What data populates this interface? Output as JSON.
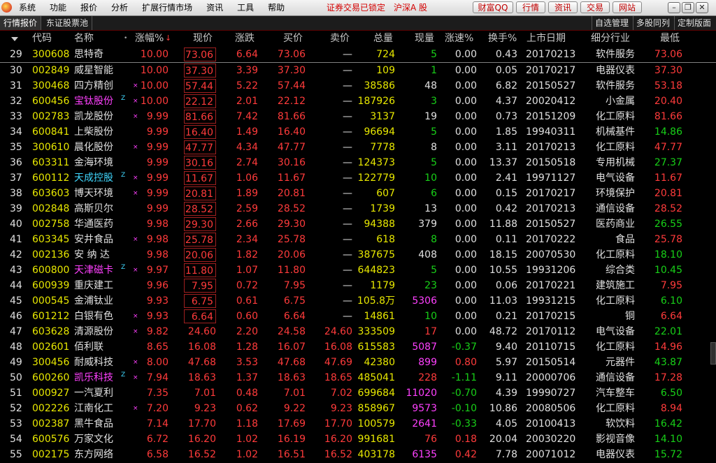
{
  "menu": [
    "系统",
    "功能",
    "报价",
    "分析",
    "扩展行情市场",
    "资讯",
    "工具",
    "帮助"
  ],
  "status_lock": "证券交易已锁定",
  "market_selector": "沪深A 股",
  "toolbar_buttons": [
    "财富QQ",
    "行情",
    "资讯",
    "交易",
    "网站"
  ],
  "window_controls": [
    "minimize",
    "restore",
    "close"
  ],
  "tabs": [
    "行情报价",
    "东证股票池"
  ],
  "right_tabs": [
    "自选管理",
    "多股同列",
    "定制版面"
  ],
  "columns": [
    "代码",
    "名称",
    "•",
    "涨幅%",
    "现价",
    "涨跌",
    "买价",
    "卖价",
    "总量",
    "现量",
    "涨速%",
    "换手%",
    "上市日期",
    "细分行业",
    "最低"
  ],
  "sort_indicator": "↓",
  "colors": {
    "up": "#ff3b3b",
    "down": "#18d018",
    "code": "#e8e800",
    "name_highlight": "#ff40ff",
    "name_cyan": "#40d8ff",
    "text": "#e0e0e0"
  },
  "rows": [
    {
      "n": "29",
      "code": "300608",
      "name": "思特奇",
      "nc": "w",
      "flag": "",
      "mark": "",
      "chg": "10.00",
      "price": "73.06",
      "diff": "6.64",
      "bid": "73.06",
      "ask": "—",
      "vol": "724",
      "cur": "5",
      "curc": "g",
      "speed": "0.00",
      "spc": "w",
      "turn": "0.43",
      "date": "20170213",
      "ind": "软件服务",
      "low": "73.06",
      "lowc": "r"
    },
    {
      "n": "30",
      "code": "002849",
      "name": "威星智能",
      "nc": "w",
      "flag": "",
      "mark": "",
      "chg": "10.00",
      "price": "37.30",
      "diff": "3.39",
      "bid": "37.30",
      "ask": "—",
      "vol": "109",
      "cur": "1",
      "curc": "g",
      "speed": "0.00",
      "spc": "w",
      "turn": "0.05",
      "date": "20170217",
      "ind": "电器仪表",
      "low": "37.30",
      "lowc": "r"
    },
    {
      "n": "31",
      "code": "300468",
      "name": "四方精创",
      "nc": "w",
      "flag": "",
      "mark": "×",
      "chg": "10.00",
      "price": "57.44",
      "diff": "5.22",
      "bid": "57.44",
      "ask": "—",
      "vol": "38586",
      "cur": "48",
      "curc": "w",
      "speed": "0.00",
      "spc": "w",
      "turn": "6.82",
      "date": "20150527",
      "ind": "软件服务",
      "low": "53.18",
      "lowc": "r"
    },
    {
      "n": "32",
      "code": "600456",
      "name": "宝钛股份",
      "nc": "m",
      "flag": "Z",
      "mark": "×",
      "chg": "10.00",
      "price": "22.12",
      "diff": "2.01",
      "bid": "22.12",
      "ask": "—",
      "vol": "187926",
      "cur": "3",
      "curc": "g",
      "speed": "0.00",
      "spc": "w",
      "turn": "4.37",
      "date": "20020412",
      "ind": "小金属",
      "low": "20.40",
      "lowc": "r"
    },
    {
      "n": "33",
      "code": "002783",
      "name": "凯龙股份",
      "nc": "w",
      "flag": "",
      "mark": "×",
      "chg": "9.99",
      "price": "81.66",
      "diff": "7.42",
      "bid": "81.66",
      "ask": "—",
      "vol": "3137",
      "cur": "19",
      "curc": "w",
      "speed": "0.00",
      "spc": "w",
      "turn": "0.73",
      "date": "20151209",
      "ind": "化工原料",
      "low": "81.66",
      "lowc": "r"
    },
    {
      "n": "34",
      "code": "600841",
      "name": "上柴股份",
      "nc": "w",
      "flag": "",
      "mark": "",
      "chg": "9.99",
      "price": "16.40",
      "diff": "1.49",
      "bid": "16.40",
      "ask": "—",
      "vol": "96694",
      "cur": "5",
      "curc": "g",
      "speed": "0.00",
      "spc": "w",
      "turn": "1.85",
      "date": "19940311",
      "ind": "机械基件",
      "low": "14.86",
      "lowc": "g"
    },
    {
      "n": "35",
      "code": "300610",
      "name": "晨化股份",
      "nc": "w",
      "flag": "",
      "mark": "×",
      "chg": "9.99",
      "price": "47.77",
      "diff": "4.34",
      "bid": "47.77",
      "ask": "—",
      "vol": "7778",
      "cur": "8",
      "curc": "w",
      "speed": "0.00",
      "spc": "w",
      "turn": "3.11",
      "date": "20170213",
      "ind": "化工原料",
      "low": "47.77",
      "lowc": "r"
    },
    {
      "n": "36",
      "code": "603311",
      "name": "金海环境",
      "nc": "w",
      "flag": "",
      "mark": "",
      "chg": "9.99",
      "price": "30.16",
      "diff": "2.74",
      "bid": "30.16",
      "ask": "—",
      "vol": "124373",
      "cur": "5",
      "curc": "g",
      "speed": "0.00",
      "spc": "w",
      "turn": "13.37",
      "date": "20150518",
      "ind": "专用机械",
      "low": "27.37",
      "lowc": "g"
    },
    {
      "n": "37",
      "code": "600112",
      "name": "天成控股",
      "nc": "c",
      "flag": "Z",
      "mark": "×",
      "chg": "9.99",
      "price": "11.67",
      "diff": "1.06",
      "bid": "11.67",
      "ask": "—",
      "vol": "122779",
      "cur": "10",
      "curc": "g",
      "speed": "0.00",
      "spc": "w",
      "turn": "2.41",
      "date": "19971127",
      "ind": "电气设备",
      "low": "11.67",
      "lowc": "r"
    },
    {
      "n": "38",
      "code": "603603",
      "name": "博天环境",
      "nc": "w",
      "flag": "",
      "mark": "×",
      "chg": "9.99",
      "price": "20.81",
      "diff": "1.89",
      "bid": "20.81",
      "ask": "—",
      "vol": "607",
      "cur": "6",
      "curc": "g",
      "speed": "0.00",
      "spc": "w",
      "turn": "0.15",
      "date": "20170217",
      "ind": "环境保护",
      "low": "20.81",
      "lowc": "r"
    },
    {
      "n": "39",
      "code": "002848",
      "name": "高斯贝尔",
      "nc": "w",
      "flag": "",
      "mark": "",
      "chg": "9.99",
      "price": "28.52",
      "diff": "2.59",
      "bid": "28.52",
      "ask": "—",
      "vol": "1739",
      "cur": "13",
      "curc": "w",
      "speed": "0.00",
      "spc": "w",
      "turn": "0.42",
      "date": "20170213",
      "ind": "通信设备",
      "low": "28.52",
      "lowc": "r"
    },
    {
      "n": "40",
      "code": "002758",
      "name": "华通医药",
      "nc": "w",
      "flag": "",
      "mark": "",
      "chg": "9.98",
      "price": "29.30",
      "diff": "2.66",
      "bid": "29.30",
      "ask": "—",
      "vol": "94388",
      "cur": "379",
      "curc": "w",
      "speed": "0.00",
      "spc": "w",
      "turn": "11.88",
      "date": "20150527",
      "ind": "医药商业",
      "low": "26.55",
      "lowc": "g"
    },
    {
      "n": "41",
      "code": "603345",
      "name": "安井食品",
      "nc": "w",
      "flag": "",
      "mark": "×",
      "chg": "9.98",
      "price": "25.78",
      "diff": "2.34",
      "bid": "25.78",
      "ask": "—",
      "vol": "618",
      "cur": "8",
      "curc": "g",
      "speed": "0.00",
      "spc": "w",
      "turn": "0.11",
      "date": "20170222",
      "ind": "食品",
      "low": "25.78",
      "lowc": "r"
    },
    {
      "n": "42",
      "code": "002136",
      "name": "安 纳 达",
      "nc": "w",
      "flag": "",
      "mark": "",
      "chg": "9.98",
      "price": "20.06",
      "diff": "1.82",
      "bid": "20.06",
      "ask": "—",
      "vol": "387675",
      "cur": "408",
      "curc": "w",
      "speed": "0.00",
      "spc": "w",
      "turn": "18.15",
      "date": "20070530",
      "ind": "化工原料",
      "low": "18.10",
      "lowc": "g"
    },
    {
      "n": "43",
      "code": "600800",
      "name": "天津磁卡",
      "nc": "m",
      "flag": "Z",
      "mark": "×",
      "chg": "9.97",
      "price": "11.80",
      "diff": "1.07",
      "bid": "11.80",
      "ask": "—",
      "vol": "644823",
      "cur": "5",
      "curc": "g",
      "speed": "0.00",
      "spc": "w",
      "turn": "10.55",
      "date": "19931206",
      "ind": "综合类",
      "low": "10.45",
      "lowc": "g"
    },
    {
      "n": "44",
      "code": "600939",
      "name": "重庆建工",
      "nc": "w",
      "flag": "",
      "mark": "",
      "chg": "9.96",
      "price": "7.95",
      "diff": "0.72",
      "bid": "7.95",
      "ask": "—",
      "vol": "1179",
      "cur": "23",
      "curc": "g",
      "speed": "0.00",
      "spc": "w",
      "turn": "0.06",
      "date": "20170221",
      "ind": "建筑施工",
      "low": "7.95",
      "lowc": "r"
    },
    {
      "n": "45",
      "code": "000545",
      "name": "金浦钛业",
      "nc": "w",
      "flag": "",
      "mark": "",
      "chg": "9.93",
      "price": "6.75",
      "diff": "0.61",
      "bid": "6.75",
      "ask": "—",
      "vol": "105.8万",
      "cur": "5306",
      "curc": "m",
      "speed": "0.00",
      "spc": "w",
      "turn": "11.03",
      "date": "19931215",
      "ind": "化工原料",
      "low": "6.10",
      "lowc": "g"
    },
    {
      "n": "46",
      "code": "601212",
      "name": "白银有色",
      "nc": "w",
      "flag": "",
      "mark": "×",
      "chg": "9.93",
      "price": "6.64",
      "diff": "0.60",
      "bid": "6.64",
      "ask": "—",
      "vol": "14861",
      "cur": "10",
      "curc": "g",
      "speed": "0.00",
      "spc": "w",
      "turn": "0.21",
      "date": "20170215",
      "ind": "铜",
      "low": "6.64",
      "lowc": "r"
    },
    {
      "n": "47",
      "code": "603628",
      "name": "清源股份",
      "nc": "w",
      "flag": "",
      "mark": "×",
      "chg": "9.82",
      "price": "24.60",
      "diff": "2.20",
      "bid": "24.58",
      "ask": "24.60",
      "vol": "333509",
      "cur": "17",
      "curc": "r",
      "speed": "0.00",
      "spc": "w",
      "turn": "48.72",
      "date": "20170112",
      "ind": "电气设备",
      "low": "22.01",
      "lowc": "g"
    },
    {
      "n": "48",
      "code": "002601",
      "name": "佰利联",
      "nc": "w",
      "flag": "",
      "mark": "",
      "chg": "8.65",
      "price": "16.08",
      "diff": "1.28",
      "bid": "16.07",
      "ask": "16.08",
      "vol": "615583",
      "cur": "5087",
      "curc": "m",
      "speed": "-0.37",
      "spc": "g",
      "turn": "9.40",
      "date": "20110715",
      "ind": "化工原料",
      "low": "14.96",
      "lowc": "r"
    },
    {
      "n": "49",
      "code": "300456",
      "name": "耐威科技",
      "nc": "w",
      "flag": "",
      "mark": "×",
      "chg": "8.00",
      "price": "47.68",
      "diff": "3.53",
      "bid": "47.68",
      "ask": "47.69",
      "vol": "42380",
      "cur": "899",
      "curc": "m",
      "speed": "0.80",
      "spc": "r",
      "turn": "5.97",
      "date": "20150514",
      "ind": "元器件",
      "low": "43.87",
      "lowc": "g"
    },
    {
      "n": "50",
      "code": "600260",
      "name": "凯乐科技",
      "nc": "m",
      "flag": "Z",
      "mark": "×",
      "chg": "7.94",
      "price": "18.63",
      "diff": "1.37",
      "bid": "18.63",
      "ask": "18.65",
      "vol": "485041",
      "cur": "228",
      "curc": "r",
      "speed": "-1.11",
      "spc": "g",
      "turn": "9.11",
      "date": "20000706",
      "ind": "通信设备",
      "low": "17.28",
      "lowc": "r"
    },
    {
      "n": "51",
      "code": "000927",
      "name": "一汽夏利",
      "nc": "w",
      "flag": "",
      "mark": "",
      "chg": "7.35",
      "price": "7.01",
      "diff": "0.48",
      "bid": "7.01",
      "ask": "7.02",
      "vol": "699684",
      "cur": "11020",
      "curc": "m",
      "speed": "-0.70",
      "spc": "g",
      "turn": "4.39",
      "date": "19990727",
      "ind": "汽车整车",
      "low": "6.50",
      "lowc": "g"
    },
    {
      "n": "52",
      "code": "002226",
      "name": "江南化工",
      "nc": "w",
      "flag": "",
      "mark": "×",
      "chg": "7.20",
      "price": "9.23",
      "diff": "0.62",
      "bid": "9.22",
      "ask": "9.23",
      "vol": "858967",
      "cur": "9573",
      "curc": "m",
      "speed": "-0.10",
      "spc": "g",
      "turn": "10.86",
      "date": "20080506",
      "ind": "化工原料",
      "low": "8.94",
      "lowc": "r"
    },
    {
      "n": "53",
      "code": "002387",
      "name": "黑牛食品",
      "nc": "w",
      "flag": "",
      "mark": "",
      "chg": "7.14",
      "price": "17.70",
      "diff": "1.18",
      "bid": "17.69",
      "ask": "17.70",
      "vol": "100579",
      "cur": "2641",
      "curc": "m",
      "speed": "-0.33",
      "spc": "g",
      "turn": "4.05",
      "date": "20100413",
      "ind": "软饮料",
      "low": "16.42",
      "lowc": "g"
    },
    {
      "n": "54",
      "code": "600576",
      "name": "万家文化",
      "nc": "w",
      "flag": "",
      "mark": "",
      "chg": "6.72",
      "price": "16.20",
      "diff": "1.02",
      "bid": "16.19",
      "ask": "16.20",
      "vol": "991681",
      "cur": "76",
      "curc": "r",
      "speed": "0.18",
      "spc": "r",
      "turn": "20.04",
      "date": "20030220",
      "ind": "影视音像",
      "low": "14.10",
      "lowc": "g"
    },
    {
      "n": "55",
      "code": "002175",
      "name": "东方网络",
      "nc": "w",
      "flag": "",
      "mark": "",
      "chg": "6.58",
      "price": "16.52",
      "diff": "1.02",
      "bid": "16.51",
      "ask": "16.52",
      "vol": "403178",
      "cur": "6135",
      "curc": "m",
      "speed": "0.42",
      "spc": "r",
      "turn": "7.78",
      "date": "20071012",
      "ind": "电器仪表",
      "low": "15.72",
      "lowc": "g"
    }
  ]
}
